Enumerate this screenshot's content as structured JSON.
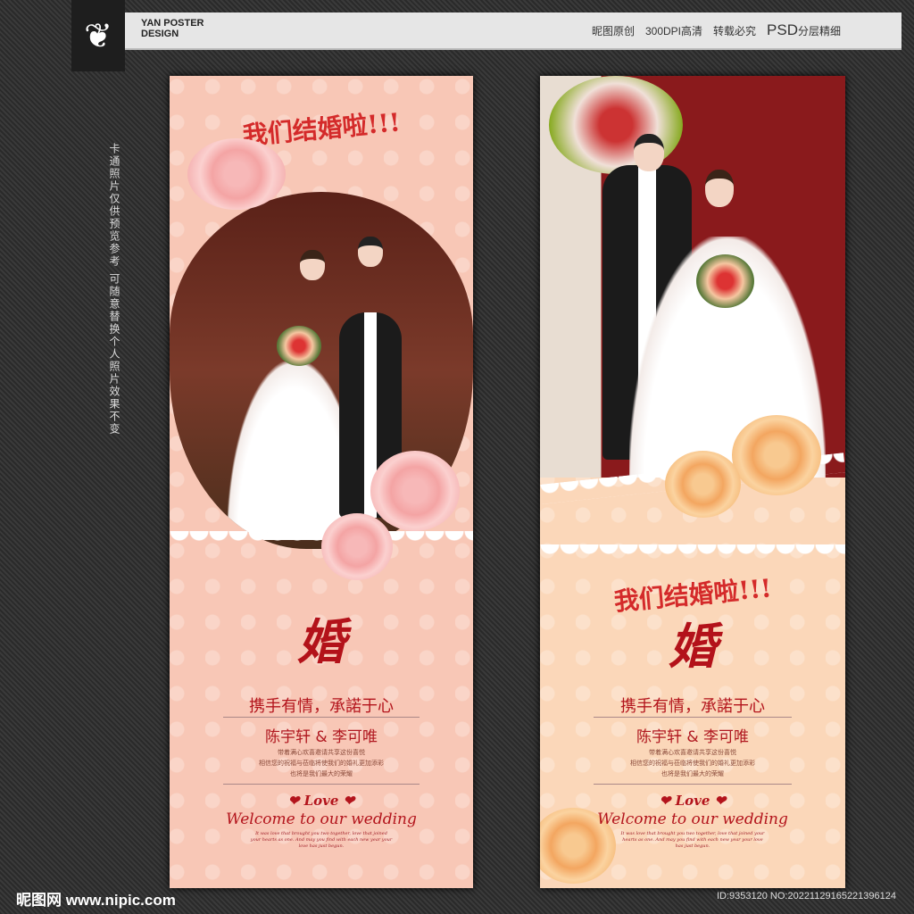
{
  "header": {
    "logo_glyph": "❦",
    "brand_line1": "YAN POSTER",
    "brand_line2": "DESIGN",
    "tags": [
      "昵图原创",
      "300DPI高清",
      "转载必究"
    ],
    "psd_label": "PSD",
    "psd_suffix": "分层精细"
  },
  "side_note": "卡通照片仅供预览参考 可随意替换个人照片效果不变",
  "poster": {
    "title": "我们结婚啦!!!",
    "hun": "婚",
    "slogan": "携手有情，承諾于心",
    "names": "陈宇轩 & 李可唯",
    "lines": [
      "带着满心欢喜邀请共享这份喜悦",
      "相信您的祝福与莅临将使我们的婚礼更加添彩",
      "也将是我们最大的荣耀"
    ],
    "love": "❤ Love ❤",
    "welcome": "Welcome to our wedding",
    "english": "It was love that brought you two together, love that joined your hearts as one. And may you find with each new year your love has just begun."
  },
  "footer": {
    "site": "昵图网 www.nipic.com",
    "id": "ID:9353120 NO:20221129165221396124"
  }
}
